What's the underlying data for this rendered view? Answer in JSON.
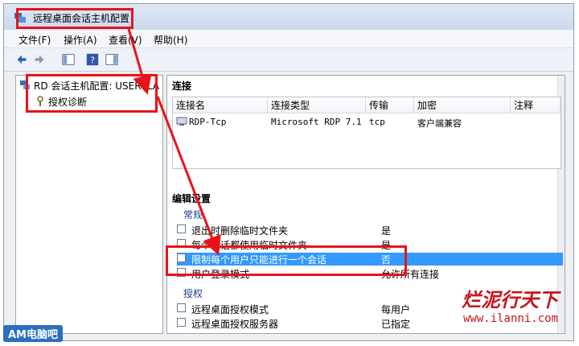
{
  "window": {
    "title": "远程桌面会话主机配置"
  },
  "menu": [
    "文件(F)",
    "操作(A)",
    "查看(V)",
    "帮助(H)"
  ],
  "tree": {
    "root": "RD 会话主机配置: USER-ILA",
    "child": "授权诊断"
  },
  "connections": {
    "header": "连接",
    "columns": [
      "连接名",
      "连接类型",
      "传输",
      "加密",
      "注释"
    ],
    "rows": [
      {
        "name": "RDP-Tcp",
        "type": "Microsoft RDP 7.1",
        "transport": "tcp",
        "encryption": "客户端兼容",
        "comment": ""
      }
    ]
  },
  "settings": {
    "header": "编辑设置",
    "general_label": "常规",
    "general_rows": [
      {
        "label": "退出时删除临时文件夹",
        "value": "是"
      },
      {
        "label": "每个会话都使用临时文件夹",
        "value": "是"
      },
      {
        "label": "限制每个用户只能进行一个会话",
        "value": "否"
      },
      {
        "label": "用户登录模式",
        "value": "允许所有连接"
      }
    ],
    "license_label": "授权",
    "license_rows": [
      {
        "label": "远程桌面授权模式",
        "value": "每用户"
      },
      {
        "label": "远程桌面授权服务器",
        "value": "已指定"
      }
    ]
  },
  "watermark": {
    "brand": "烂泥行天下",
    "url": "www.ilanni.com"
  },
  "logo": {
    "text": "AM电脑吧"
  },
  "colors": {
    "highlight": "#e8131a",
    "selection": "#3399ff"
  }
}
